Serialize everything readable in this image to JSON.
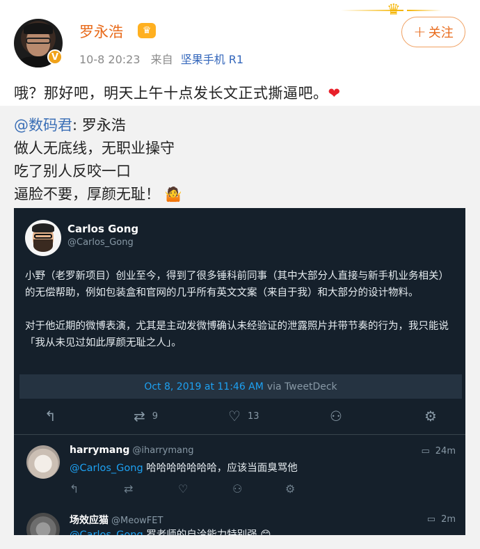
{
  "post": {
    "username": "罗永浩",
    "time": "10-8 20:23",
    "from_label": "来自",
    "device": "坚果手机 R1",
    "follow_label": "关注",
    "text": "哦？那好吧，明天上午十点发长文正式撕逼吧。",
    "verified_mark": "V"
  },
  "repost": {
    "user": "@数码君",
    "colon_text": ": 罗永浩",
    "lines": [
      "做人无底线，无职业操守",
      "吃了别人反咬一口",
      "逼脸不要，厚颜无耻！"
    ]
  },
  "tweet": {
    "name": "Carlos Gong",
    "handle": "@Carlos_Gong",
    "paragraph1": "小野（老罗新项目）创业至今，得到了很多锤科前同事（其中大部分人直接与新手机业务相关）的无偿帮助，例如包装盒和官网的几乎所有英文文案（来自于我）和大部分的设计物料。",
    "paragraph2": "对于他近期的微博表演，尤其是主动发微博确认未经验证的泄露照片并带节奏的行为，我只能说「我从未见过如此厚颜无耻之人」。",
    "date": "Oct 8, 2019 at 11:46 AM",
    "via": "via TweetDeck",
    "retweets": "9",
    "likes": "13"
  },
  "replies": [
    {
      "name": "harrymang",
      "handle": "@iharrymang",
      "time": "24m",
      "mention": "@Carlos_Gong",
      "text": " 哈哈哈哈哈哈哈，应该当面臭骂他"
    },
    {
      "name": "场效应猫",
      "handle": "@MeowFET",
      "time": "2m",
      "mention": "@Carlos_Gong",
      "text": " 罗老师的自洽能力特别强"
    }
  ],
  "icons": {
    "crown": "crown-icon",
    "heart": "heart-icon",
    "reply": "reply-icon",
    "retweet": "retweet-icon",
    "like": "like-icon",
    "follow": "follow-person-icon",
    "settings": "settings-icon"
  },
  "colors": {
    "accent": "#e86a1a",
    "link": "#3b6fb6",
    "tweet_bg": "#15202b",
    "tweet_link": "#1da1f2"
  }
}
